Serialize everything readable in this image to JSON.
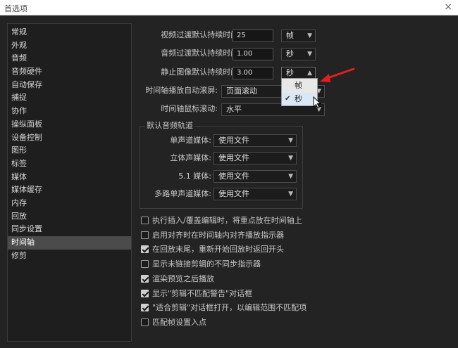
{
  "window": {
    "title": "首选项",
    "close_glyph": "×"
  },
  "sidebar": {
    "items": [
      {
        "label": "常规"
      },
      {
        "label": "外观"
      },
      {
        "label": "音频"
      },
      {
        "label": "音频硬件"
      },
      {
        "label": "自动保存"
      },
      {
        "label": "捕捉"
      },
      {
        "label": "协作"
      },
      {
        "label": "操纵面板"
      },
      {
        "label": "设备控制"
      },
      {
        "label": "图形"
      },
      {
        "label": "标签"
      },
      {
        "label": "媒体"
      },
      {
        "label": "媒体缓存"
      },
      {
        "label": "内存"
      },
      {
        "label": "回放"
      },
      {
        "label": "同步设置"
      },
      {
        "label": "时间轴",
        "active": true
      },
      {
        "label": "修剪"
      }
    ]
  },
  "durations": {
    "video_label": "视频过渡默认持续时间:",
    "video_value": "25",
    "video_unit": "帧",
    "audio_label": "音频过渡默认持续时间:",
    "audio_value": "1.00",
    "audio_unit": "秒",
    "still_label": "静止图像默认持续时间:",
    "still_value": "3.00",
    "still_unit": "秒"
  },
  "scroll": {
    "playback_label": "时间轴播放自动滚屏:",
    "playback_value": "页面滚动",
    "mouse_label": "时间轴鼠标滚动:",
    "mouse_value": "水平"
  },
  "audio_tracks": {
    "title": "默认音频轨道",
    "mono_label": "单声道媒体:",
    "mono_value": "使用文件",
    "stereo_label": "立体声媒体:",
    "stereo_value": "使用文件",
    "surround_label": "5.1 媒体:",
    "surround_value": "使用文件",
    "multi_label": "多路单声道媒体:",
    "multi_value": "使用文件"
  },
  "checkboxes": [
    {
      "label": "执行插入/覆盖编辑时，将重点放在时间轴上",
      "checked": false
    },
    {
      "label": "启用对齐时在时间轴内对齐播放指示器",
      "checked": false
    },
    {
      "label": "在回放末尾，重新开始回放时返回开头",
      "checked": true
    },
    {
      "label": "显示未链接剪辑的不同步指示器",
      "checked": false
    },
    {
      "label": "渲染预览之后播放",
      "checked": true
    },
    {
      "label": "显示\"剪辑不匹配警告\"对话框",
      "checked": true
    },
    {
      "label": "\"适合剪辑\"对话框打开，以编辑范围不匹配项",
      "checked": true
    },
    {
      "label": "匹配帧设置入点",
      "checked": false
    }
  ],
  "unit_dropdown": {
    "options": [
      "帧",
      "秒"
    ],
    "selected": "秒",
    "check_glyph": "✔"
  },
  "icons": {
    "chevron": "chevron-down-icon",
    "annotation_arrow_color": "#e0201c"
  }
}
